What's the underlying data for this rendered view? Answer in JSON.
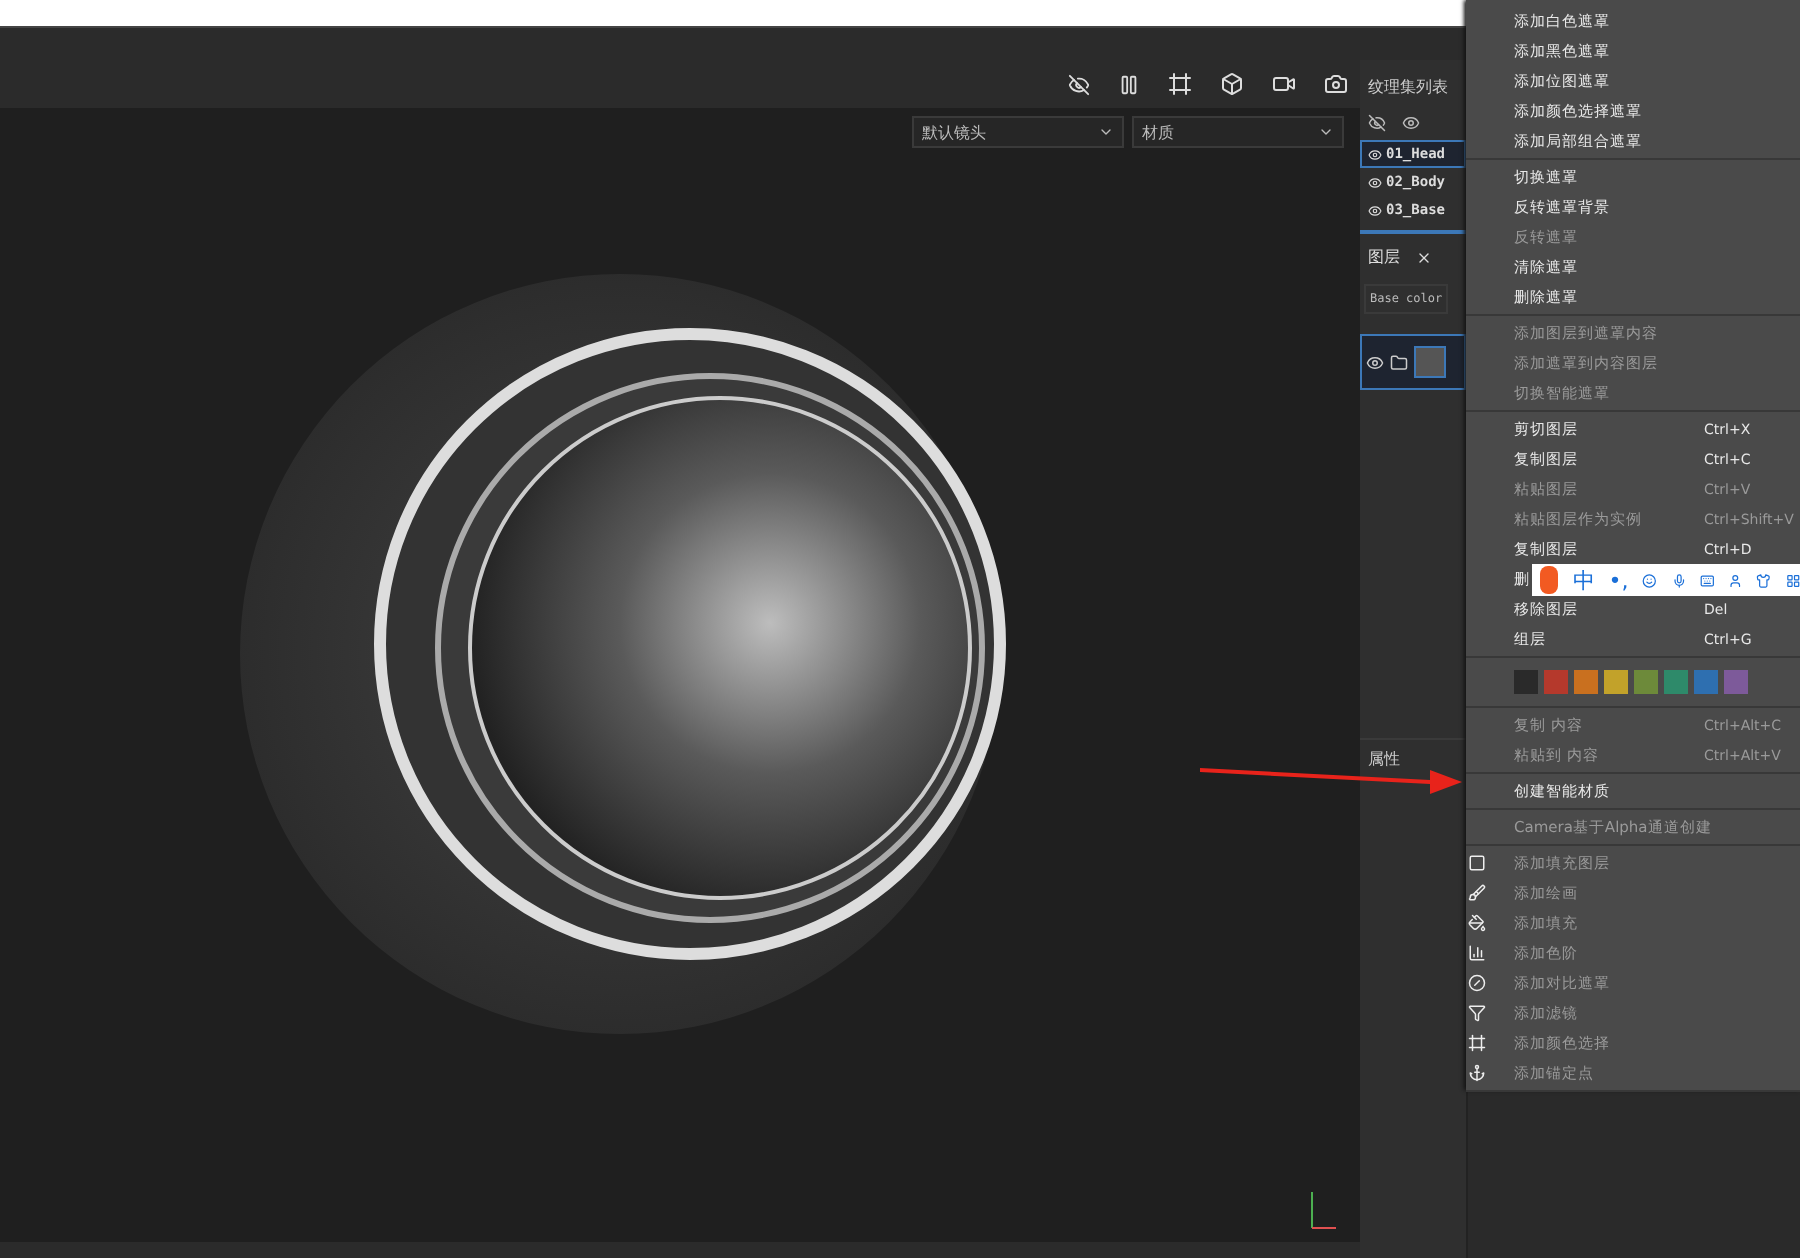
{
  "viewport": {
    "camera_dropdown": "默认镜头",
    "material_dropdown": "材质"
  },
  "texture_sets": {
    "title": "纹理集列表",
    "items": [
      {
        "name": "01_Head",
        "selected": true
      },
      {
        "name": "02_Body",
        "selected": false
      },
      {
        "name": "03_Base",
        "selected": false
      }
    ]
  },
  "layers": {
    "tab": "图层",
    "channel_dropdown": "Base color"
  },
  "properties": {
    "title": "属性"
  },
  "context_menu": {
    "groups": [
      [
        {
          "label": "添加白色遮罩",
          "disabled": false
        },
        {
          "label": "添加黑色遮罩",
          "disabled": false
        },
        {
          "label": "添加位图遮罩",
          "disabled": false
        },
        {
          "label": "添加颜色选择遮罩",
          "disabled": false
        },
        {
          "label": "添加局部组合遮罩",
          "disabled": false
        }
      ],
      [
        {
          "label": "切换遮罩",
          "disabled": false
        },
        {
          "label": "反转遮罩背景",
          "disabled": false
        },
        {
          "label": "反转遮罩",
          "disabled": true
        },
        {
          "label": "清除遮罩",
          "disabled": false
        },
        {
          "label": "删除遮罩",
          "disabled": false
        }
      ],
      [
        {
          "label": "添加图层到遮罩内容",
          "disabled": true
        },
        {
          "label": "添加遮罩到内容图层",
          "disabled": true
        },
        {
          "label": "切换智能遮罩",
          "disabled": true
        }
      ],
      [
        {
          "label": "剪切图层",
          "shortcut": "Ctrl+X",
          "disabled": false
        },
        {
          "label": "复制图层",
          "shortcut": "Ctrl+C",
          "disabled": false
        },
        {
          "label": "粘贴图层",
          "shortcut": "Ctrl+V",
          "disabled": true
        },
        {
          "label": "粘贴图层作为实例",
          "shortcut": "Ctrl+Shift+V",
          "disabled": true
        },
        {
          "label": "复制图层",
          "shortcut": "Ctrl+D",
          "disabled": false
        },
        {
          "label": "删",
          "disabled": false
        },
        {
          "label": "移除图层",
          "shortcut": "Del",
          "disabled": false
        },
        {
          "label": "组层",
          "shortcut": "Ctrl+G",
          "disabled": false
        }
      ],
      [
        {
          "kind": "swatches",
          "swatches": [
            {
              "color": "#2a2a2a"
            },
            {
              "color": "#b5392c"
            },
            {
              "color": "#c9701f"
            },
            {
              "color": "#c2a22a"
            },
            {
              "color": "#6d8a3a"
            },
            {
              "color": "#2e8a6a"
            },
            {
              "color": "#2e6fb0"
            },
            {
              "color": "#7d5a9a"
            }
          ]
        }
      ],
      [
        {
          "label": "复制 内容",
          "shortcut": "Ctrl+Alt+C",
          "disabled": true
        },
        {
          "label": "粘贴到 内容",
          "shortcut": "Ctrl+Alt+V",
          "disabled": true
        }
      ],
      [
        {
          "label": "创建智能材质",
          "disabled": false
        }
      ],
      [
        {
          "label": "Camera基于Alpha通道创建",
          "disabled": true
        }
      ],
      [
        {
          "label": "添加填充图层",
          "disabled": true
        },
        {
          "label": "添加绘画",
          "disabled": true
        },
        {
          "label": "添加填充",
          "disabled": true
        },
        {
          "label": "添加色阶",
          "disabled": true
        },
        {
          "label": "添加对比遮罩",
          "disabled": true
        },
        {
          "label": "添加滤镜",
          "disabled": true
        },
        {
          "label": "添加颜色选择",
          "disabled": true
        },
        {
          "label": "添加锚定点",
          "disabled": true
        }
      ]
    ]
  },
  "ime_toolbar": {
    "items": [
      "中",
      "•,"
    ]
  }
}
